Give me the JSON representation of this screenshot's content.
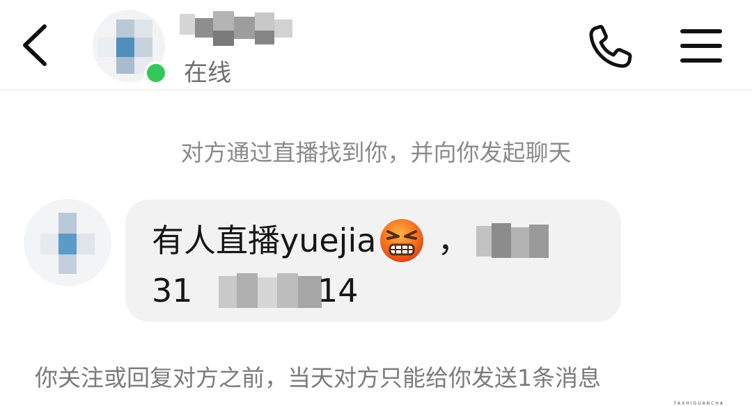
{
  "header": {
    "back_icon": "chevron-left-icon",
    "contact_name": "",
    "status": "在线",
    "call_icon": "phone-icon",
    "menu_icon": "hamburger-menu-icon",
    "online_color": "#34c759"
  },
  "chat": {
    "system_notice": "对方通过直播找到你，并向你发起聊天",
    "message": {
      "line1_text": "有人直播yuejia",
      "emoji": "angry-face-emoji",
      "line1_after": "，",
      "line2_prefix": "31",
      "line2_suffix": "14"
    },
    "footer_notice": "你关注或回复对方之前，当天对方只能给你发送1条消息"
  },
  "watermark": "FAXHIGUANCHA",
  "colors": {
    "bubble_bg": "#f2f2f2",
    "text_primary": "#161616",
    "text_secondary": "#8a8a8a"
  }
}
